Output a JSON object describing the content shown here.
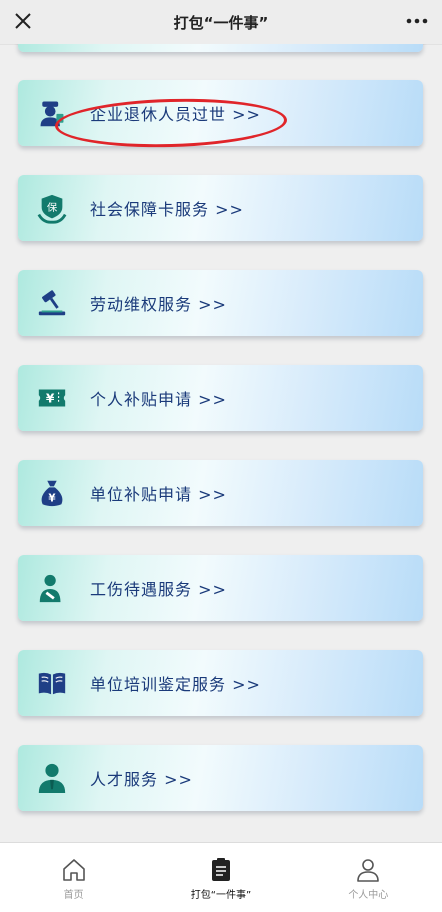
{
  "header": {
    "title": "打包“一件事”",
    "close_icon": "close-icon",
    "more_icon": "more-icon"
  },
  "services": [
    {
      "label": "企业退休人员过世 >>",
      "icon": "retiree-icon"
    },
    {
      "label": "社会保障卡服务 >>",
      "icon": "social-security-card-icon"
    },
    {
      "label": "劳动维权服务 >>",
      "icon": "gavel-icon"
    },
    {
      "label": "个人补贴申请 >>",
      "icon": "yuan-ticket-icon"
    },
    {
      "label": "单位补贴申请 >>",
      "icon": "money-bag-icon"
    },
    {
      "label": "工伤待遇服务 >>",
      "icon": "injured-worker-icon"
    },
    {
      "label": "单位培训鉴定服务 >>",
      "icon": "book-icon"
    },
    {
      "label": "人才服务 >>",
      "icon": "talent-person-icon"
    }
  ],
  "highlighted_item": "企业退休人员过世 >>",
  "tabs": [
    {
      "label": "首页",
      "icon": "home-icon",
      "active": false
    },
    {
      "label": "打包“一件事”",
      "icon": "clipboard-icon",
      "active": true
    },
    {
      "label": "个人中心",
      "icon": "user-icon",
      "active": false
    }
  ],
  "colors": {
    "accent_text": "#1a3a7a",
    "icon_blue": "#1f3f86",
    "icon_teal": "#127a6c",
    "highlight": "#e0252a"
  }
}
